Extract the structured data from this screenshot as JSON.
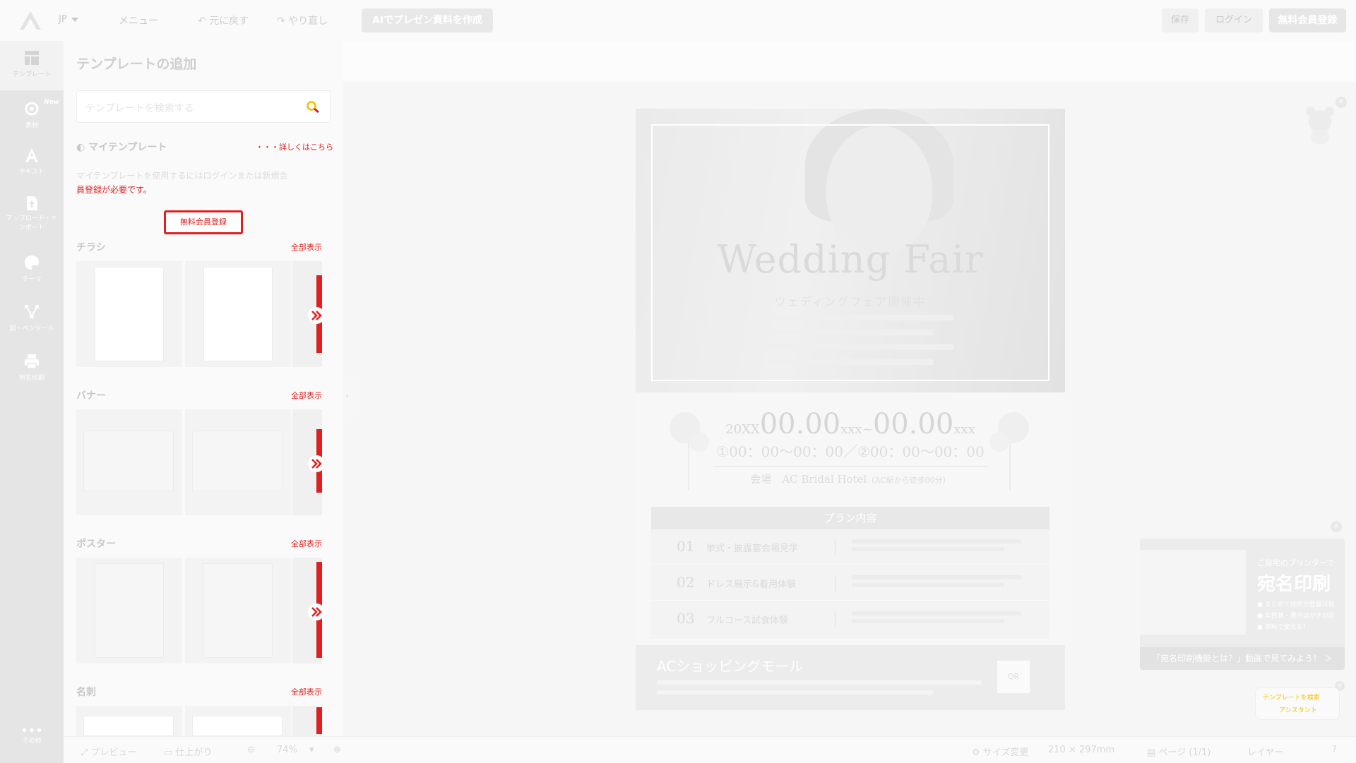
{
  "topbar": {
    "lang": "JP",
    "menu": "メニュー",
    "undo": "元に戻す",
    "redo": "やり直し",
    "ai_button": "AIでプレゼン資料を作成",
    "save": "保存",
    "login": "ログイン",
    "register": "無料会員登録"
  },
  "rail": {
    "items": [
      {
        "label": "テンプレート",
        "icon": "template-icon"
      },
      {
        "label": "素材",
        "icon": "gear-icon",
        "badge": "New"
      },
      {
        "label": "テキスト",
        "icon": "text-icon"
      },
      {
        "label": "アップロード・インポート",
        "icon": "upload-icon"
      },
      {
        "label": "テーマ",
        "icon": "palette-icon"
      },
      {
        "label": "図・ペンツール",
        "icon": "pen-tool-icon"
      },
      {
        "label": "宛名印刷",
        "icon": "printer-icon"
      }
    ],
    "more": "その他"
  },
  "panel": {
    "title": "テンプレートの追加",
    "search_placeholder": "テンプレートを検索する",
    "my_templates": "マイテンプレート",
    "my_templates_link": "・・・詳しくはこちら",
    "my_templates_desc": "マイテンプレートを使用するにはログインまたは新規会",
    "my_templates_desc_red": "員登録が必要です。",
    "my_templates_button": "無料会員登録",
    "show_all": "全部表示",
    "sections": [
      {
        "title": "チラシ"
      },
      {
        "title": "バナー"
      },
      {
        "title": "ポスター"
      },
      {
        "title": "名刺"
      }
    ]
  },
  "document": {
    "title": "Wedding Fair",
    "subtitle": "ウェディングフェア開催中",
    "date_prefix_1": "20XX",
    "date_1": "00.00",
    "date_suffix_1": "xxx",
    "tilde": "~",
    "date_2": "00.00",
    "date_suffix_2": "xxx",
    "time_line": "①00：00～00：00／②00：00～00：00",
    "venue_label": "会場",
    "venue_name": "AC Bridal Hotel",
    "venue_note": "（AC駅から徒歩00分）",
    "plan_title": "プラン内容",
    "plans": [
      {
        "num": "01",
        "name": "挙式・披露宴会場見学"
      },
      {
        "num": "02",
        "name": "ドレス展示&着用体験"
      },
      {
        "num": "03",
        "name": "フルコース試食体験"
      }
    ],
    "footer_title": "ACショッピングモール",
    "qr_label": "QR"
  },
  "ad": {
    "heading_small": "ご自宅のプリンターで",
    "heading_big": "宛名印刷",
    "bullets": [
      "まとめて住所が登録可能",
      "年賀状・喪中はがき対応",
      "無料で使える！"
    ],
    "cta": "「宛名印刷機能とは？」動画で見てみよう！ ＞"
  },
  "bubble": {
    "line1": "テンプレートを検索",
    "line2": "アシスタント"
  },
  "statusbar": {
    "preview": "プレビュー",
    "finish": "仕上がり",
    "zoom": "74%",
    "size_change": "サイズ変更",
    "size_value": "210 × 297mm",
    "page": "ページ",
    "page_count": "(1/1)",
    "layer": "レイヤー"
  }
}
